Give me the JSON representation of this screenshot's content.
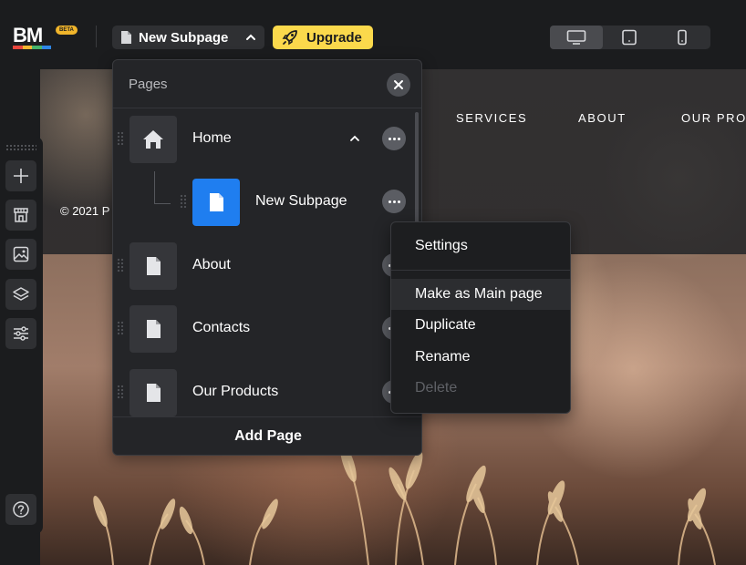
{
  "app": {
    "logo_text": "BM",
    "logo_badge": "BETA",
    "logo_stripe_colors": [
      "#e8463d",
      "#f2b631",
      "#47b26a",
      "#2e86e6"
    ],
    "current_page_label": "New Subpage",
    "upgrade_label": "Upgrade",
    "device_buttons": [
      {
        "name": "desktop",
        "active": true
      },
      {
        "name": "tablet",
        "active": false
      },
      {
        "name": "mobile",
        "active": false
      }
    ],
    "accent_color": "#1f7ef0",
    "upgrade_color": "#fbd94c"
  },
  "sidebar": {
    "tools": [
      "add-icon",
      "store-icon",
      "image-icon",
      "layers-icon",
      "sliders-icon"
    ],
    "help_icon": "help-icon"
  },
  "site": {
    "nav": [
      "SERVICES",
      "ABOUT",
      "OUR PRO"
    ],
    "copyright": "© 2021 P"
  },
  "pages_panel": {
    "title": "Pages",
    "pages": [
      {
        "label": "Home",
        "icon": "home-icon",
        "selected": false,
        "expanded": true
      },
      {
        "label": "New Subpage",
        "icon": "page-icon",
        "selected": true,
        "child": true
      },
      {
        "label": "About",
        "icon": "page-icon",
        "selected": false
      },
      {
        "label": "Contacts",
        "icon": "page-icon",
        "selected": false
      },
      {
        "label": "Our Products",
        "icon": "page-icon",
        "selected": false
      }
    ],
    "add_page_label": "Add Page"
  },
  "context_menu": {
    "items": [
      {
        "label": "Settings",
        "disabled": false
      },
      {
        "label": "Make as Main page",
        "disabled": false,
        "hover": true
      },
      {
        "label": "Duplicate",
        "disabled": false
      },
      {
        "label": "Rename",
        "disabled": false
      },
      {
        "label": "Delete",
        "disabled": true
      }
    ]
  }
}
